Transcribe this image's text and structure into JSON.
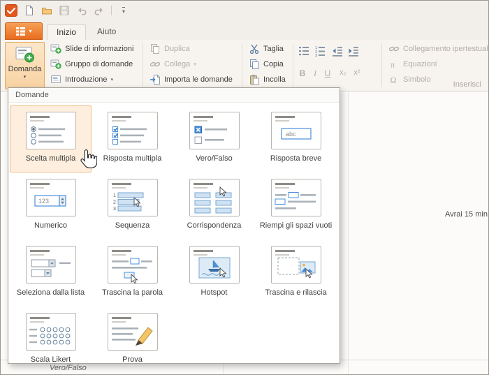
{
  "titlebar": {
    "icons": [
      "app-logo",
      "new-document",
      "open-folder",
      "save",
      "undo",
      "redo",
      "customize-toolbar"
    ]
  },
  "tabs": {
    "items": [
      {
        "label": "Inizio",
        "active": true
      },
      {
        "label": "Aiuto",
        "active": false
      }
    ]
  },
  "ribbon": {
    "domanda": {
      "label": "Domanda"
    },
    "question_group": {
      "slide_info": "Slide di informazioni",
      "question_group": "Gruppo di domande",
      "intro": "Introduzione"
    },
    "manage_group": {
      "duplicate": "Duplica",
      "link": "Collega",
      "import": "Importa le domande"
    },
    "clipboard_group": {
      "cut": "Taglia",
      "copy": "Copia",
      "paste": "Incolla"
    },
    "format_group": {
      "bold": "B",
      "italic": "I",
      "underline": "U",
      "subscript": "x₂",
      "superscript": "x²"
    },
    "insert_group": {
      "hyperlink": "Collegamento ipertestuale",
      "equations": "Equazioni",
      "symbol": "Simbolo",
      "group_label": "Inserisci"
    }
  },
  "menu": {
    "title": "Domande",
    "tiles": [
      {
        "label": "Scelta multipla",
        "icon": "multiple-choice",
        "selected": true
      },
      {
        "label": "Risposta multipla",
        "icon": "multiple-response",
        "selected": false
      },
      {
        "label": "Vero/Falso",
        "icon": "true-false",
        "selected": false
      },
      {
        "label": "Risposta breve",
        "icon": "short-answer",
        "selected": false
      },
      {
        "label": "Numerico",
        "icon": "numeric",
        "selected": false
      },
      {
        "label": "Sequenza",
        "icon": "sequence",
        "selected": false
      },
      {
        "label": "Corrispondenza",
        "icon": "matching",
        "selected": false
      },
      {
        "label": "Riempi gli spazi vuoti",
        "icon": "fill-blanks",
        "selected": false
      },
      {
        "label": "Seleziona dalla lista",
        "icon": "select-list",
        "selected": false
      },
      {
        "label": "Trascina la parola",
        "icon": "drag-word",
        "selected": false
      },
      {
        "label": "Hotspot",
        "icon": "hotspot",
        "selected": false
      },
      {
        "label": "Trascina e rilascia",
        "icon": "drag-drop",
        "selected": false
      },
      {
        "label": "Scala Likert",
        "icon": "likert",
        "selected": false
      },
      {
        "label": "Prova",
        "icon": "essay",
        "selected": false
      }
    ]
  },
  "content": {
    "time_note": "Avrai 15 min",
    "bottom_row_label": "Vero/Falso"
  },
  "colors": {
    "accent_orange": "#e86c1e",
    "selection_bg": "#fdeedd",
    "selection_border": "#f0c08a",
    "tile_blue": "#4a90d9",
    "add_green": "#3fae49"
  }
}
